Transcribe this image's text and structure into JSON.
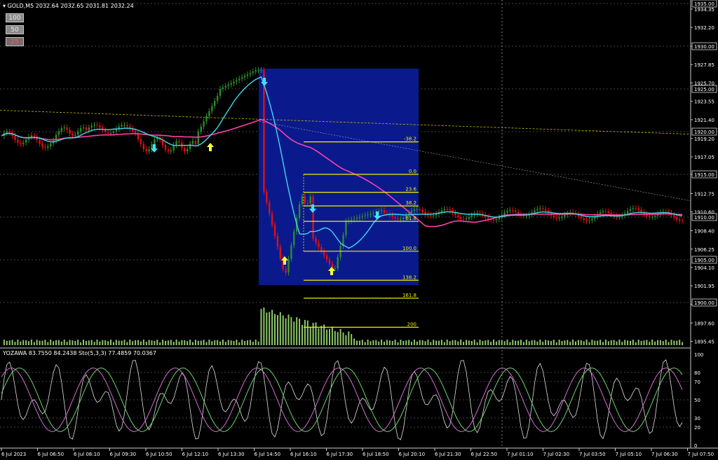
{
  "header": {
    "symbol": "GOLD,M5",
    "prices": "2032.64 2032.65 2031.81 2032.24"
  },
  "buttons": [
    {
      "label": "100",
      "active": false
    },
    {
      "label": "50",
      "active": false
    },
    {
      "label": "25",
      "active": true
    }
  ],
  "indicator": {
    "label": "YOZAWA 83.7550 84.2438  Sto(5,3,3) 77.4859 70.0367"
  },
  "colors": {
    "bull": "#2e8b2e",
    "bear": "#e01010",
    "ma_fast": "#40d8f0",
    "ma_slow": "#ff3fa8",
    "fib": "#f0f000",
    "zone": "#0a1a8c",
    "grid": "#8a8a8a",
    "axis_text": "#ffffff"
  },
  "price_axis": {
    "ticks": [
      "1934.35",
      "1932.20",
      "1930.00",
      "1927.85",
      "1925.70",
      "1923.55",
      "1921.40",
      "1919.20",
      "1917.05",
      "1915.00",
      "1912.75",
      "1910.60",
      "1908.40",
      "1906.25",
      "1904.10",
      "1901.95",
      "1899.80",
      "1897.60",
      "1895.45"
    ],
    "boxed_levels": [
      "1935.00",
      "1930.00",
      "1925.00",
      "1920.00",
      "1915.00",
      "1910.00",
      "1905.00",
      "1900.00"
    ]
  },
  "osc_axis": {
    "ticks": [
      "100",
      "80",
      "70",
      "50",
      "30",
      "20",
      "0"
    ]
  },
  "fib_levels": [
    {
      "label": "-38.2",
      "price": 1918.8
    },
    {
      "label": "0.0",
      "price": 1915.0
    },
    {
      "label": "23.6",
      "price": 1912.9
    },
    {
      "label": "38.2",
      "price": 1911.3
    },
    {
      "label": "61.8",
      "price": 1909.5
    },
    {
      "label": "100.0",
      "price": 1906.0
    },
    {
      "label": "138.2",
      "price": 1902.6
    },
    {
      "label": "161.8",
      "price": 1900.5
    },
    {
      "label": "200",
      "price": 1897.1
    }
  ],
  "time_axis": {
    "labels": [
      "6 Jul 2023",
      "6 Jul 06:50",
      "6 Jul 08:10",
      "6 Jul 09:30",
      "6 Jul 10:50",
      "6 Jul 12:10",
      "6 Jul 13:30",
      "6 Jul 14:50",
      "6 Jul 16:10",
      "6 Jul 17:30",
      "6 Jul 18:50",
      "6 Jul 20:10",
      "6 Jul 21:30",
      "6 Jul 22:50",
      "7 Jul 01:10",
      "7 Jul 02:30",
      "7 Jul 03:50",
      "7 Jul 05:10",
      "7 Jul 06:30",
      "7 Jul 07:50"
    ]
  }
}
